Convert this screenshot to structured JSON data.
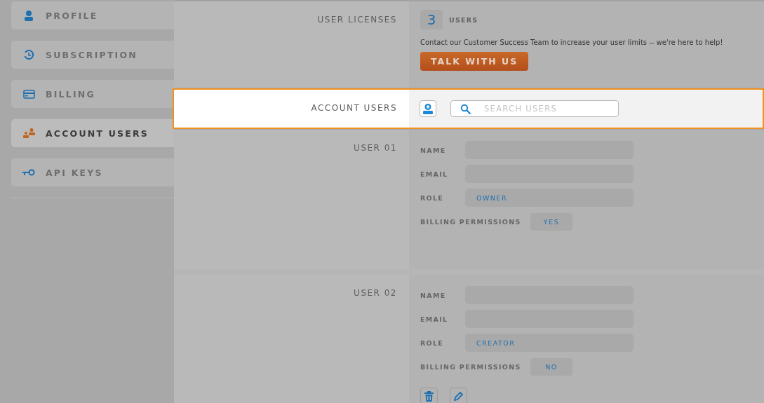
{
  "sidebar": {
    "items": [
      {
        "label": "PROFILE",
        "kind": "person",
        "selected": false
      },
      {
        "label": "SUBSCRIPTION",
        "kind": "renew",
        "selected": false
      },
      {
        "label": "BILLING",
        "kind": "card",
        "selected": false
      },
      {
        "label": "ACCOUNT USERS",
        "kind": "users",
        "selected": true
      },
      {
        "label": "API KEYS",
        "kind": "key",
        "selected": false
      }
    ]
  },
  "licenses": {
    "label": "USER LICENSES",
    "count": "3",
    "unit": "USERS",
    "message": "Contact our Customer Success Team to increase your user limits -- we're here to help!",
    "button": "TALK WITH US"
  },
  "account_users": {
    "label": "ACCOUNT USERS",
    "highlighted": true,
    "search": {
      "placeholder": "SEARCH USERS"
    }
  },
  "users": [
    {
      "label": "USER 01",
      "fields": [
        {
          "label": "NAME"
        },
        {
          "label": "EMAIL"
        },
        {
          "label": "ROLE",
          "value": "OWNER"
        }
      ],
      "billing": {
        "label": "BILLING PERMISSIONS",
        "value": "YES"
      },
      "actions": false
    },
    {
      "label": "USER 02",
      "fields": [
        {
          "label": "NAME"
        },
        {
          "label": "EMAIL"
        },
        {
          "label": "ROLE",
          "value": "CREATOR"
        }
      ],
      "billing": {
        "label": "BILLING PERMISSIONS",
        "value": "NO"
      },
      "actions": true
    }
  ]
}
